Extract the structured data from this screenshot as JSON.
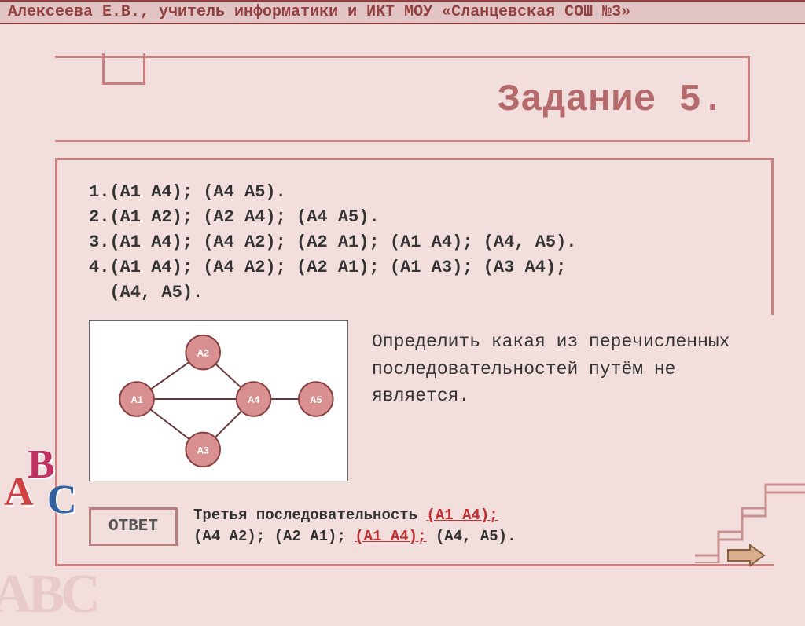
{
  "header": "Алексеева Е.В., учитель информатики и ИКТ МОУ «Сланцевская СОШ №3»",
  "title": "Задание 5.",
  "sequences": {
    "s1": "1.(А1 А4); (А4 А5).",
    "s2": "2.(А1 А2); (А2 А4); (А4 А5).",
    "s3": "3.(А1 А4); (А4 А2); (А2 А1); (А1 А4); (А4, А5).",
    "s4a": "4.(А1 А4); (А4 А2); (А2 А1); (А1 А3); (А3 А4);",
    "s4b": "  (А4, А5)."
  },
  "graph": {
    "nodes": {
      "a1": "A1",
      "a2": "A2",
      "a3": "A3",
      "a4": "A4",
      "a5": "A5"
    }
  },
  "question": "Определить какая из перечисленных последовательностей путём не является.",
  "answer_label": "ОТВЕТ",
  "answer": {
    "pre": "Третья последовательность ",
    "hl1": "(А1 А4);",
    "mid": " (А4 А2); (А2 А1); ",
    "hl2": "(А1 А4);",
    "post": " (А4, А5)."
  },
  "deco": {
    "A": "A",
    "B": "B",
    "C": "C",
    "ghost": "ABC"
  }
}
